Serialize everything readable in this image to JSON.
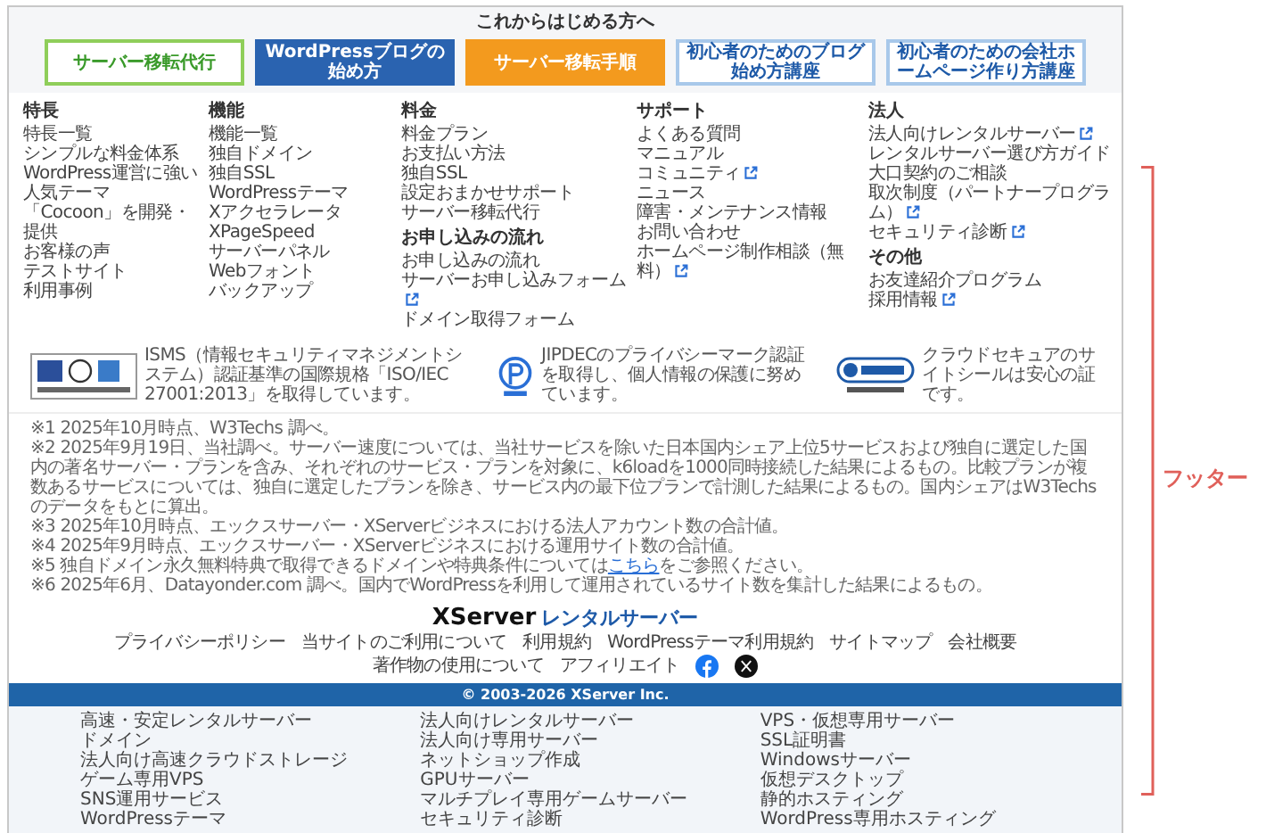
{
  "intro": {
    "title": "これからはじめる方へ",
    "banners": [
      {
        "text": "サーバー移転代行",
        "kind": "green"
      },
      {
        "text": "WordPressブログの始め方",
        "kind": "blue"
      },
      {
        "text": "サーバー移転手順",
        "kind": "orange"
      },
      {
        "text": "初心者のためのブログ始め方講座",
        "kind": "outline"
      },
      {
        "text": "初心者のための会社ホームページ作り方講座",
        "kind": "outline"
      }
    ]
  },
  "columns": [
    {
      "groups": [
        {
          "heading": "特長",
          "links": [
            {
              "text": "特長一覧",
              "external": false
            },
            {
              "text": "シンプルな料金体系",
              "external": false
            },
            {
              "text": "WordPress運営に強い",
              "external": false
            },
            {
              "text": "人気テーマ「Cocoon」を開発・提供",
              "external": false
            },
            {
              "text": "お客様の声",
              "external": false
            },
            {
              "text": "テストサイト",
              "external": false
            },
            {
              "text": "利用事例",
              "external": false
            }
          ]
        }
      ]
    },
    {
      "groups": [
        {
          "heading": "機能",
          "links": [
            {
              "text": "機能一覧",
              "external": false
            },
            {
              "text": "独自ドメイン",
              "external": false
            },
            {
              "text": "独自SSL",
              "external": false
            },
            {
              "text": "WordPressテーマ",
              "external": false
            },
            {
              "text": "Xアクセラレータ",
              "external": false
            },
            {
              "text": "XPageSpeed",
              "external": false
            },
            {
              "text": "サーバーパネル",
              "external": false
            },
            {
              "text": "Webフォント",
              "external": false
            },
            {
              "text": "バックアップ",
              "external": false
            }
          ]
        }
      ]
    },
    {
      "groups": [
        {
          "heading": "料金",
          "links": [
            {
              "text": "料金プラン",
              "external": false
            },
            {
              "text": "お支払い方法",
              "external": false
            },
            {
              "text": "独自SSL",
              "external": false
            },
            {
              "text": "設定おまかせサポート",
              "external": false
            },
            {
              "text": "サーバー移転代行",
              "external": false
            }
          ]
        },
        {
          "heading": "お申し込みの流れ",
          "links": [
            {
              "text": "お申し込みの流れ",
              "external": false
            },
            {
              "text": "サーバーお申し込みフォーム",
              "external": true
            },
            {
              "text": "ドメイン取得フォーム",
              "external": false
            }
          ]
        }
      ]
    },
    {
      "groups": [
        {
          "heading": "サポート",
          "links": [
            {
              "text": "よくある質問",
              "external": false
            },
            {
              "text": "マニュアル",
              "external": false
            },
            {
              "text": "コミュニティ",
              "external": true
            },
            {
              "text": "ニュース",
              "external": false
            },
            {
              "text": "障害・メンテナンス情報",
              "external": false
            },
            {
              "text": "お問い合わせ",
              "external": false
            },
            {
              "text": "ホームページ制作相談（無料）",
              "external": true
            }
          ]
        }
      ]
    },
    {
      "groups": [
        {
          "heading": "法人",
          "links": [
            {
              "text": "法人向けレンタルサーバー",
              "external": true
            },
            {
              "text": "レンタルサーバー選び方ガイド",
              "external": false
            },
            {
              "text": "大口契約のご相談",
              "external": false
            },
            {
              "text": "取次制度（パートナープログラム）",
              "external": true
            },
            {
              "text": "セキュリティ診断",
              "external": true
            }
          ]
        },
        {
          "heading": "その他",
          "links": [
            {
              "text": "お友達紹介プログラム",
              "external": false
            },
            {
              "text": "採用情報",
              "external": true
            }
          ]
        }
      ]
    }
  ],
  "certifications": [
    {
      "kind": "isms",
      "text": "ISMS（情報セキュリティマネジメントシステム）認証基準の国際規格「ISO/IEC 27001:2013」を取得しています。"
    },
    {
      "kind": "privacy",
      "text": "JIPDECのプライバシーマーク認証を取得し、個人情報の保護に努めています。"
    },
    {
      "kind": "cloudsecure",
      "text": "クラウドセキュアのサイトシールは安心の証です。"
    }
  ],
  "notes": [
    {
      "text": "※1 2025年10月時点、W3Techs 調べ。"
    },
    {
      "text": "※2 2025年9月19日、当社調べ。サーバー速度については、当社サービスを除いた日本国内シェア上位5サービスおよび独自に選定した国内の著名サーバー・プランを含み、それぞれのサービス・プランを対象に、k6loadを1000同時接続した結果によるもの。比較プランが複数あるサービスについては、独自に選定したプランを除き、サービス内の最下位プランで計測した結果によるもの。国内シェアはW3Techsのデータをもとに算出。"
    },
    {
      "text": "※3 2025年10月時点、エックスサーバー・XServerビジネスにおける法人アカウント数の合計値。"
    },
    {
      "text": "※4 2025年9月時点、エックスサーバー・XServerビジネスにおける運用サイト数の合計値。"
    },
    {
      "text": "※5 独自ドメイン永久無料特典で取得できるドメインや特典条件については",
      "link": "こちら",
      "rest": "をご参照ください。"
    },
    {
      "text": "※6 2025年6月、Datayonder.com 調べ。国内でWordPressを利用して運用されているサイト数を集計した結果によるもの。"
    }
  ],
  "logo": {
    "brand": "XServer",
    "product": "レンタルサーバー"
  },
  "nav": [
    "プライバシーポリシー",
    "当サイトのご利用について",
    "利用規約",
    "WordPressテーマ利用規約",
    "サイトマップ",
    "会社概要",
    "著作物の使用について",
    "アフィリエイト"
  ],
  "social": [
    {
      "kind": "facebook"
    },
    {
      "kind": "x"
    }
  ],
  "copyright": "© 2003-2026 XServer Inc.",
  "services": [
    [
      "高速・安定レンタルサーバー",
      "ドメイン",
      "法人向け高速クラウドストレージ",
      "ゲーム専用VPS",
      "SNS運用サービス",
      "WordPressテーマ"
    ],
    [
      "法人向けレンタルサーバー",
      "法人向け専用サーバー",
      "ネットショップ作成",
      "GPUサーバー",
      "マルチプレイ専用ゲームサーバー",
      "セキュリティ診断"
    ],
    [
      "VPS・仮想専用サーバー",
      "SSL証明書",
      "Windowsサーバー",
      "仮想デスクトップ",
      "静的ホスティング",
      "WordPress専用ホスティング"
    ]
  ],
  "annotation": "フッター"
}
